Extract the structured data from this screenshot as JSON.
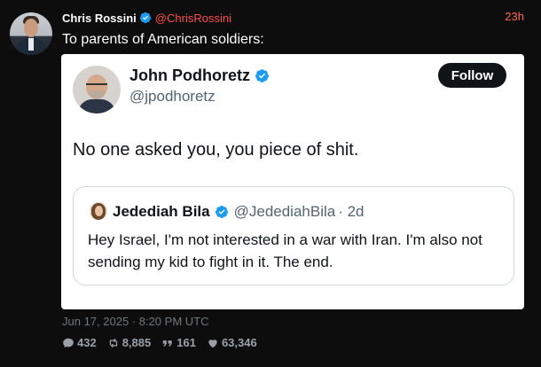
{
  "tweet": {
    "author_name": "Chris Rossini",
    "author_handle": "@ChrisRossini",
    "time_ago": "23h",
    "text": "To parents of American soldiers:",
    "date": "Jun 17, 2025 · 8:20 PM UTC",
    "stats": {
      "replies": "432",
      "retweets": "8,885",
      "quotes": "161",
      "likes": "63,346"
    }
  },
  "embed": {
    "author_name": "John Podhoretz",
    "author_handle": "@jpodhoretz",
    "follow_label": "Follow",
    "text": "No one asked you, you piece of shit.",
    "quote": {
      "author_name": "Jedediah Bila",
      "author_handle": "@JedediahBila",
      "time": "· 2d",
      "text": "Hey Israel, I'm not interested in a war with Iran. I'm also not sending my kid to fight in it. The end."
    }
  },
  "colors": {
    "background": "#0d0d0d",
    "verified_blue": "#1d9bf0",
    "handle_red": "#ff4d4d"
  },
  "icons": [
    "verified-badge-icon",
    "reply-icon",
    "retweet-icon",
    "quote-icon",
    "heart-icon"
  ]
}
